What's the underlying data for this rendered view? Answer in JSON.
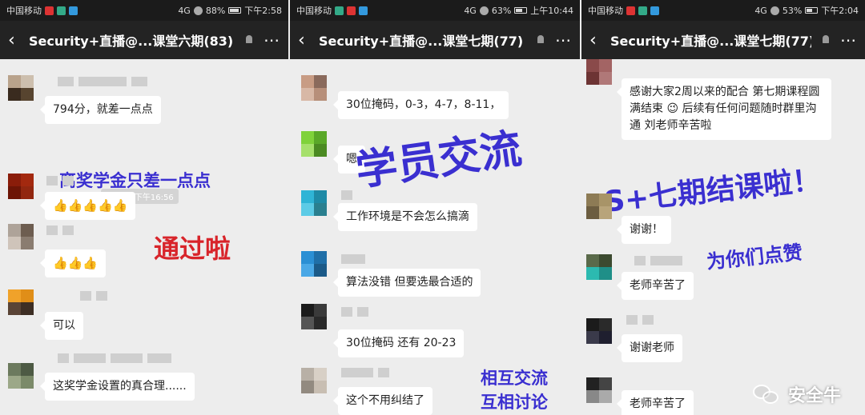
{
  "panels": [
    {
      "status": {
        "carrier": "中国移动",
        "battery": "88%",
        "time": "下午2:58",
        "network": "4G"
      },
      "header": {
        "title": "Security+直播@...课堂六期(83)"
      },
      "messages": [
        {
          "text": "794分，就差一点点"
        },
        {
          "text": "👍👍👍👍👍"
        },
        {
          "text": "👍👍👍"
        },
        {
          "text": "可以"
        },
        {
          "text": "这奖学金设置的真合理......"
        }
      ],
      "timestamp": "8月3日 下午16:56",
      "overlays": {
        "top": "离奖学金只差一点点",
        "middle": "通过啦"
      }
    },
    {
      "status": {
        "carrier": "中国移动",
        "battery": "63%",
        "time": "上午10:44",
        "network": "4G"
      },
      "header": {
        "title": "Security+直播@...课堂七期(77)"
      },
      "messages": [
        {
          "text": "30位掩码，0-3，4-7，8-11，"
        },
        {
          "text": "嗯"
        },
        {
          "text": "工作环境是不会怎么搞滴"
        },
        {
          "text": "算法没错 但要选最合适的"
        },
        {
          "text": "30位掩码 还有 20-23"
        },
        {
          "text": "这个不用纠结了"
        }
      ],
      "overlays": {
        "big": "学员交流",
        "bottom1": "相互交流",
        "bottom2": "互相讨论"
      }
    },
    {
      "status": {
        "carrier": "中国移动",
        "battery": "53%",
        "time": "下午2:04",
        "network": "4G"
      },
      "header": {
        "title": "Security+直播@...课堂七期(77)"
      },
      "messages": [
        {
          "text": "感谢大家2周以来的配合 第七期课程圆满结束 😉 后续有任何问题随时群里沟通 刘老师辛苦啦"
        },
        {
          "text": "谢谢！"
        },
        {
          "text": "老师辛苦了"
        },
        {
          "text": "谢谢老师"
        },
        {
          "text": "老师辛苦了"
        }
      ],
      "overlays": {
        "big": "S+七期结课啦！",
        "small": "为你们点赞"
      }
    }
  ],
  "watermark": {
    "text": "安全牛"
  },
  "icons": {
    "back": "chevron-left-icon",
    "mute": "mute-bell-icon",
    "more": "more-dots-icon"
  }
}
